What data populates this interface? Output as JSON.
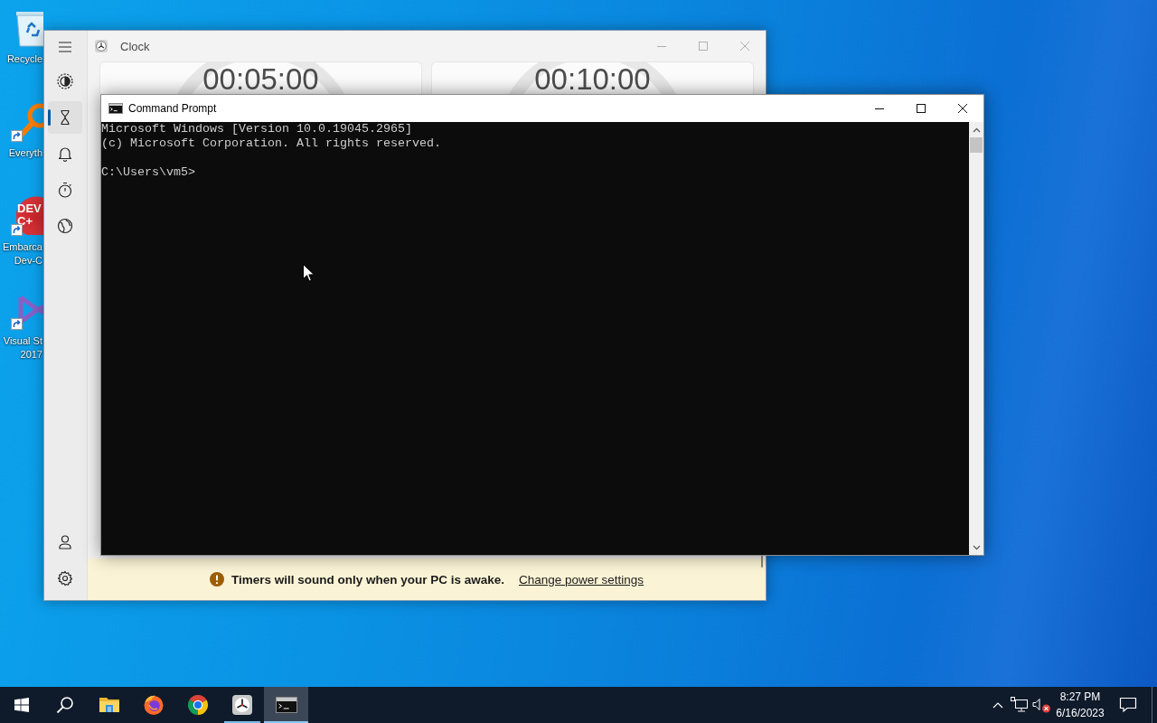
{
  "desktop_icons": [
    {
      "kind": "bin",
      "label_lines": [
        "Recycle"
      ],
      "shortcut": false
    },
    {
      "kind": "magnifier",
      "label_lines": [
        "Everyth"
      ],
      "shortcut": true
    },
    {
      "kind": "logo",
      "logo_lines": [
        "DEV",
        "C+"
      ],
      "label_lines": [
        "Embarca",
        "Dev-C"
      ],
      "shortcut": true
    },
    {
      "kind": "ribbon",
      "label_lines": [
        "Visual St",
        "2017"
      ],
      "shortcut": true
    }
  ],
  "clock_window": {
    "title": "Clock",
    "active": false,
    "nav_items": [
      {
        "kind": "focus",
        "selected": false
      },
      {
        "kind": "timer",
        "selected": true
      },
      {
        "kind": "alarm",
        "selected": false
      },
      {
        "kind": "stopwatch",
        "selected": false
      },
      {
        "kind": "world",
        "selected": false
      }
    ],
    "nav_footer": [
      {
        "kind": "account"
      },
      {
        "kind": "settings"
      }
    ],
    "timers": [
      {
        "time": "00:05:00"
      },
      {
        "time": "00:10:00"
      }
    ],
    "notice": {
      "message": "Timers will sound only when your PC is awake.",
      "link": "Change power settings"
    }
  },
  "terminal_window": {
    "title": "Command Prompt",
    "active": true,
    "lines": [
      {
        "kind": "output",
        "text": "Microsoft Windows [Version 10.0.19045.2965]"
      },
      {
        "kind": "output",
        "text": "(c) Microsoft Corporation. All rights reserved."
      },
      {
        "kind": "prompt",
        "text": "C:\\Users\\vm5>"
      }
    ]
  },
  "taskbar": {
    "apps": [
      {
        "kind": "folder",
        "running": false,
        "active": false
      },
      {
        "kind": "firefox",
        "running": false,
        "active": false
      },
      {
        "kind": "chrome",
        "running": false,
        "active": false
      },
      {
        "kind": "clock",
        "running": true,
        "active": false
      },
      {
        "kind": "console",
        "running": true,
        "active": true
      }
    ],
    "tray": {
      "sound_muted": true,
      "time": "8:27 PM",
      "date": "6/16/2023"
    }
  }
}
